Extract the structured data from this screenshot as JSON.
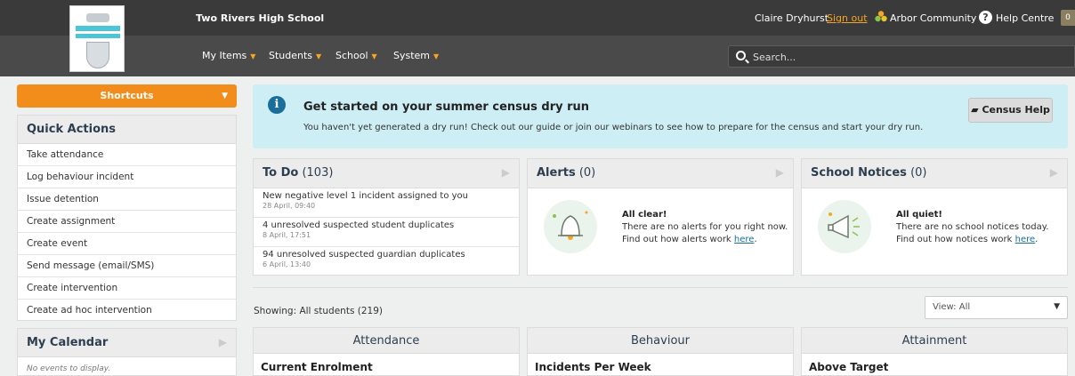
{
  "header": {
    "school_name": "Two Rivers High School",
    "user_name": "Claire Dryhurst",
    "sign_out": "Sign out",
    "arbor_community": "Arbor Community",
    "help_centre": "Help Centre",
    "notification_count": "0"
  },
  "nav": {
    "items": [
      {
        "label": "My Items"
      },
      {
        "label": "Students"
      },
      {
        "label": "School"
      },
      {
        "label": "System"
      }
    ],
    "search_placeholder": "Search..."
  },
  "sidebar": {
    "shortcuts_label": "Shortcuts",
    "quick_actions_title": "Quick Actions",
    "quick_actions": [
      "Take attendance",
      "Log behaviour incident",
      "Issue detention",
      "Create assignment",
      "Create event",
      "Send message (email/SMS)",
      "Create intervention",
      "Create ad hoc intervention"
    ],
    "calendar_title": "My Calendar",
    "calendar_empty": "No events to display."
  },
  "census": {
    "title": "Get started on your summer census dry run",
    "text": "You haven't yet generated a dry run! Check out our guide or join our webinars to see how to prepare for the census and start your dry run.",
    "button": "Census Help"
  },
  "todo": {
    "title": "To Do",
    "count": "(103)",
    "items": [
      {
        "text": "New negative level 1 incident assigned to you",
        "date": "28 April, 09:40"
      },
      {
        "text": "4 unresolved suspected student duplicates",
        "date": "8 April, 17:51"
      },
      {
        "text": "94 unresolved suspected guardian duplicates",
        "date": "6 April, 13:40"
      }
    ]
  },
  "alerts": {
    "title": "Alerts",
    "count": "(0)",
    "heading": "All clear!",
    "line1": "There are no alerts for you right now.",
    "line2_prefix": "Find out how alerts work ",
    "link": "here",
    "suffix": "."
  },
  "notices": {
    "title": "School Notices",
    "count": "(0)",
    "heading": "All quiet!",
    "line1": "There are no school notices today.",
    "line2_prefix": "Find out how notices work ",
    "link": "here",
    "suffix": "."
  },
  "dashboard": {
    "showing": "Showing: All students (219)",
    "view": "View: All",
    "sections": [
      {
        "title": "Attendance",
        "subtitle": "Current Enrolment"
      },
      {
        "title": "Behaviour",
        "subtitle": "Incidents Per Week"
      },
      {
        "title": "Attainment",
        "subtitle": "Above Target"
      }
    ]
  },
  "colors": {
    "accent": "#f28c1a",
    "header_bg": "#3a3a3a",
    "banner_bg": "#cdeef4",
    "link": "#1a6e9c"
  }
}
